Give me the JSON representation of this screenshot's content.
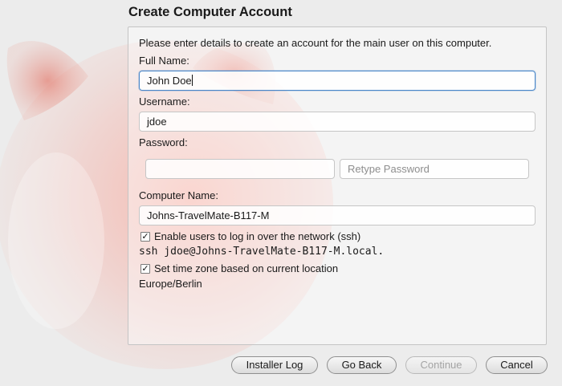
{
  "page": {
    "title": "Create Computer Account",
    "intro": "Please enter details to create an account for the main user on this computer."
  },
  "form": {
    "full_name": {
      "label": "Full Name:",
      "value": "John Doe"
    },
    "username": {
      "label": "Username:",
      "value": "jdoe"
    },
    "password": {
      "label": "Password:",
      "value": "",
      "retype_placeholder": "Retype Password"
    },
    "computer_name": {
      "label": "Computer Name:",
      "value": "Johns-TravelMate-B117-M"
    },
    "ssh": {
      "label": "Enable users to log in over the network (ssh)",
      "checked": true,
      "command": "ssh jdoe@Johns-TravelMate-B117-M.local."
    },
    "timezone": {
      "label": "Set time zone based on current location",
      "checked": true,
      "value": "Europe/Berlin"
    }
  },
  "buttons": {
    "installer_log": "Installer Log",
    "go_back": "Go Back",
    "continue": "Continue",
    "cancel": "Cancel"
  },
  "glyphs": {
    "check": "✓"
  },
  "colors": {
    "focus": "#4a87c9",
    "mascot": "#e0483a"
  }
}
